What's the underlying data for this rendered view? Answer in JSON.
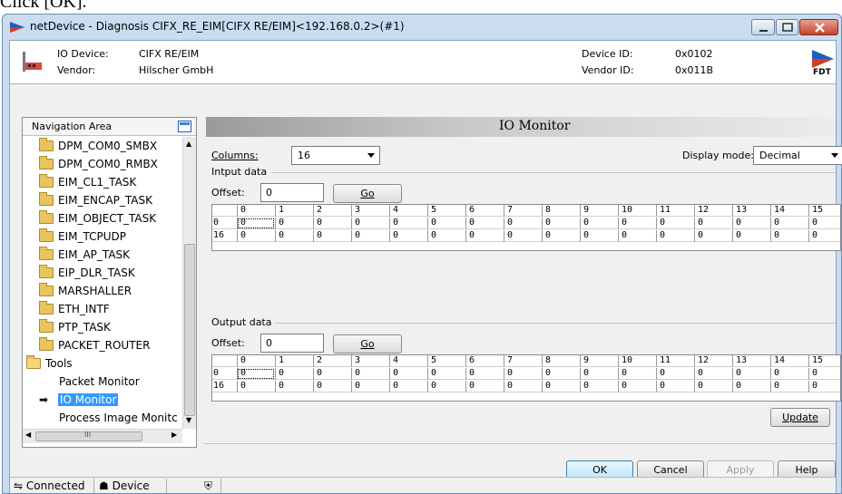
{
  "caption": "Click [OK].",
  "window": {
    "title": "netDevice - Diagnosis CIFX_RE_EIM[CIFX RE/EIM]<192.168.0.2>(#1)"
  },
  "header": {
    "io_device_label": "IO Device:",
    "io_device_value": "CIFX RE/EIM",
    "vendor_label": "Vendor:",
    "vendor_value": "Hilscher GmbH",
    "device_id_label": "Device ID:",
    "device_id_value": "0x0102",
    "vendor_id_label": "Vendor ID:",
    "vendor_id_value": "0x011B",
    "logo_text": "FDT"
  },
  "nav": {
    "title": "Navigation Area",
    "items": [
      {
        "label": "DPM_COM0_SMBX",
        "type": "folder"
      },
      {
        "label": "DPM_COM0_RMBX",
        "type": "folder"
      },
      {
        "label": "EIM_CL1_TASK",
        "type": "folder"
      },
      {
        "label": "EIM_ENCAP_TASK",
        "type": "folder"
      },
      {
        "label": "EIM_OBJECT_TASK",
        "type": "folder"
      },
      {
        "label": "EIM_TCPUDP",
        "type": "folder"
      },
      {
        "label": "EIM_AP_TASK",
        "type": "folder"
      },
      {
        "label": "EIP_DLR_TASK",
        "type": "folder"
      },
      {
        "label": "MARSHALLER",
        "type": "folder"
      },
      {
        "label": "ETH_INTF",
        "type": "folder"
      },
      {
        "label": "PTP_TASK",
        "type": "folder"
      },
      {
        "label": "PACKET_ROUTER",
        "type": "folder"
      },
      {
        "label": "Tools",
        "type": "open-folder"
      },
      {
        "label": "Packet Monitor",
        "type": "page"
      },
      {
        "label": "IO Monitor",
        "type": "page-selected"
      },
      {
        "label": "Process Image Monitc",
        "type": "page"
      }
    ],
    "hscroll_grip": "III"
  },
  "panel": {
    "title": "IO Monitor",
    "columns_label": "Columns:",
    "columns_value": "16",
    "display_mode_label": "Display mode:",
    "display_mode_value": "Decimal",
    "input": {
      "section": "Intput data",
      "offset_label": "Offset:",
      "offset_value": "0",
      "go_label": "Go"
    },
    "output": {
      "section": "Output data",
      "offset_label": "Offset:",
      "offset_value": "0",
      "go_label": "Go"
    },
    "col_headers": [
      "0",
      "1",
      "2",
      "3",
      "4",
      "5",
      "6",
      "7",
      "8",
      "9",
      "10",
      "11",
      "12",
      "13",
      "14",
      "15"
    ],
    "row_labels": [
      "0",
      "16"
    ],
    "input_rows": [
      [
        "0",
        "0",
        "0",
        "0",
        "0",
        "0",
        "0",
        "0",
        "0",
        "0",
        "0",
        "0",
        "0",
        "0",
        "0",
        "0"
      ],
      [
        "0",
        "0",
        "0",
        "0",
        "0",
        "0",
        "0",
        "0",
        "0",
        "0",
        "0",
        "0",
        "0",
        "0",
        "0",
        "0"
      ]
    ],
    "output_rows": [
      [
        "0",
        "0",
        "0",
        "0",
        "0",
        "0",
        "0",
        "0",
        "0",
        "0",
        "0",
        "0",
        "0",
        "0",
        "0",
        "0"
      ],
      [
        "0",
        "0",
        "0",
        "0",
        "0",
        "0",
        "0",
        "0",
        "0",
        "0",
        "0",
        "0",
        "0",
        "0",
        "0",
        "0"
      ]
    ],
    "update_label": "Update"
  },
  "buttons": {
    "ok": "OK",
    "cancel": "Cancel",
    "apply": "Apply",
    "help": "Help"
  },
  "status": {
    "connected": "Connected",
    "device": "Device"
  }
}
